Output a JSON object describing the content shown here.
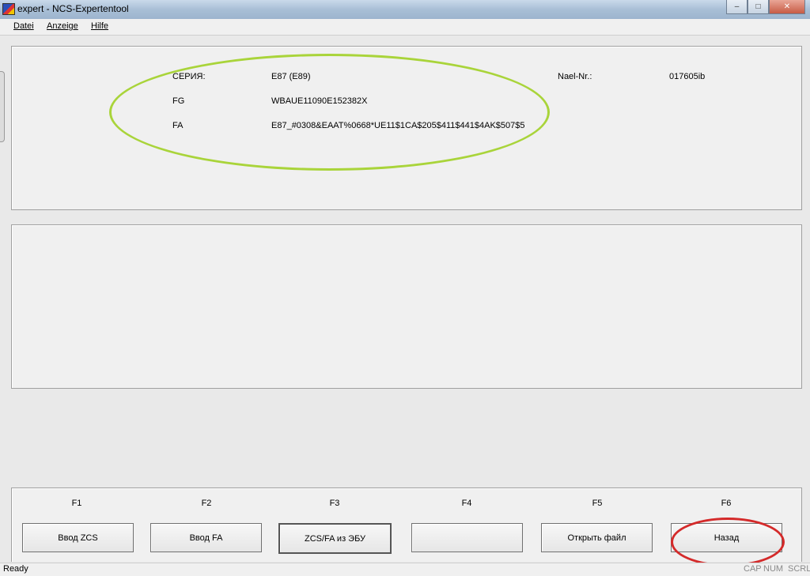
{
  "window": {
    "title": "expert - NCS-Expertentool",
    "icons": {
      "app": "app-flag-icon",
      "minimize": "minimize-icon",
      "maximize": "maximize-icon",
      "close": "close-icon"
    }
  },
  "menu": [
    "Datei",
    "Anzeige",
    "Hilfe"
  ],
  "info": {
    "series_label": "СЕРИЯ:",
    "series_value": "E87 (E89)",
    "fg_label": "FG",
    "fg_value": "WBAUE11090E152382X",
    "fa_label": "FA",
    "fa_value": "E87_#0308&EAAT%0668*UE11$1CA$205$411$441$4AK$507$5",
    "nael_label": "Nael-Nr.:",
    "nael_value": "017605ib"
  },
  "annotations": {
    "green_ellipse_color": "#a9d43a",
    "red_ellipse_color": "#d42a2a"
  },
  "function_keys": [
    {
      "key": "F1",
      "label": "Ввод ZCS"
    },
    {
      "key": "F2",
      "label": "Ввод FA"
    },
    {
      "key": "F3",
      "label": "ZCS/FA из ЭБУ"
    },
    {
      "key": "F4",
      "label": ""
    },
    {
      "key": "F5",
      "label": "Открыть файл"
    },
    {
      "key": "F6",
      "label": "Назад"
    }
  ],
  "status": {
    "text": "Ready",
    "indicators": [
      "CAP",
      "NUM",
      "SCRL"
    ]
  }
}
